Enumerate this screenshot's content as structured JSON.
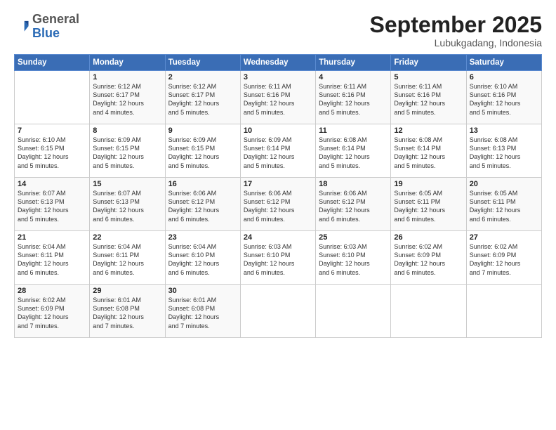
{
  "logo": {
    "general": "General",
    "blue": "Blue"
  },
  "header": {
    "month": "September 2025",
    "location": "Lubukgadang, Indonesia"
  },
  "weekdays": [
    "Sunday",
    "Monday",
    "Tuesday",
    "Wednesday",
    "Thursday",
    "Friday",
    "Saturday"
  ],
  "weeks": [
    [
      {
        "day": "",
        "sunrise": "",
        "sunset": "",
        "daylight": ""
      },
      {
        "day": "1",
        "sunrise": "Sunrise: 6:12 AM",
        "sunset": "Sunset: 6:17 PM",
        "daylight": "Daylight: 12 hours and 4 minutes."
      },
      {
        "day": "2",
        "sunrise": "Sunrise: 6:12 AM",
        "sunset": "Sunset: 6:17 PM",
        "daylight": "Daylight: 12 hours and 5 minutes."
      },
      {
        "day": "3",
        "sunrise": "Sunrise: 6:11 AM",
        "sunset": "Sunset: 6:16 PM",
        "daylight": "Daylight: 12 hours and 5 minutes."
      },
      {
        "day": "4",
        "sunrise": "Sunrise: 6:11 AM",
        "sunset": "Sunset: 6:16 PM",
        "daylight": "Daylight: 12 hours and 5 minutes."
      },
      {
        "day": "5",
        "sunrise": "Sunrise: 6:11 AM",
        "sunset": "Sunset: 6:16 PM",
        "daylight": "Daylight: 12 hours and 5 minutes."
      },
      {
        "day": "6",
        "sunrise": "Sunrise: 6:10 AM",
        "sunset": "Sunset: 6:16 PM",
        "daylight": "Daylight: 12 hours and 5 minutes."
      }
    ],
    [
      {
        "day": "7",
        "sunrise": "Sunrise: 6:10 AM",
        "sunset": "Sunset: 6:15 PM",
        "daylight": "Daylight: 12 hours and 5 minutes."
      },
      {
        "day": "8",
        "sunrise": "Sunrise: 6:09 AM",
        "sunset": "Sunset: 6:15 PM",
        "daylight": "Daylight: 12 hours and 5 minutes."
      },
      {
        "day": "9",
        "sunrise": "Sunrise: 6:09 AM",
        "sunset": "Sunset: 6:15 PM",
        "daylight": "Daylight: 12 hours and 5 minutes."
      },
      {
        "day": "10",
        "sunrise": "Sunrise: 6:09 AM",
        "sunset": "Sunset: 6:14 PM",
        "daylight": "Daylight: 12 hours and 5 minutes."
      },
      {
        "day": "11",
        "sunrise": "Sunrise: 6:08 AM",
        "sunset": "Sunset: 6:14 PM",
        "daylight": "Daylight: 12 hours and 5 minutes."
      },
      {
        "day": "12",
        "sunrise": "Sunrise: 6:08 AM",
        "sunset": "Sunset: 6:14 PM",
        "daylight": "Daylight: 12 hours and 5 minutes."
      },
      {
        "day": "13",
        "sunrise": "Sunrise: 6:08 AM",
        "sunset": "Sunset: 6:13 PM",
        "daylight": "Daylight: 12 hours and 5 minutes."
      }
    ],
    [
      {
        "day": "14",
        "sunrise": "Sunrise: 6:07 AM",
        "sunset": "Sunset: 6:13 PM",
        "daylight": "Daylight: 12 hours and 5 minutes."
      },
      {
        "day": "15",
        "sunrise": "Sunrise: 6:07 AM",
        "sunset": "Sunset: 6:13 PM",
        "daylight": "Daylight: 12 hours and 6 minutes."
      },
      {
        "day": "16",
        "sunrise": "Sunrise: 6:06 AM",
        "sunset": "Sunset: 6:12 PM",
        "daylight": "Daylight: 12 hours and 6 minutes."
      },
      {
        "day": "17",
        "sunrise": "Sunrise: 6:06 AM",
        "sunset": "Sunset: 6:12 PM",
        "daylight": "Daylight: 12 hours and 6 minutes."
      },
      {
        "day": "18",
        "sunrise": "Sunrise: 6:06 AM",
        "sunset": "Sunset: 6:12 PM",
        "daylight": "Daylight: 12 hours and 6 minutes."
      },
      {
        "day": "19",
        "sunrise": "Sunrise: 6:05 AM",
        "sunset": "Sunset: 6:11 PM",
        "daylight": "Daylight: 12 hours and 6 minutes."
      },
      {
        "day": "20",
        "sunrise": "Sunrise: 6:05 AM",
        "sunset": "Sunset: 6:11 PM",
        "daylight": "Daylight: 12 hours and 6 minutes."
      }
    ],
    [
      {
        "day": "21",
        "sunrise": "Sunrise: 6:04 AM",
        "sunset": "Sunset: 6:11 PM",
        "daylight": "Daylight: 12 hours and 6 minutes."
      },
      {
        "day": "22",
        "sunrise": "Sunrise: 6:04 AM",
        "sunset": "Sunset: 6:11 PM",
        "daylight": "Daylight: 12 hours and 6 minutes."
      },
      {
        "day": "23",
        "sunrise": "Sunrise: 6:04 AM",
        "sunset": "Sunset: 6:10 PM",
        "daylight": "Daylight: 12 hours and 6 minutes."
      },
      {
        "day": "24",
        "sunrise": "Sunrise: 6:03 AM",
        "sunset": "Sunset: 6:10 PM",
        "daylight": "Daylight: 12 hours and 6 minutes."
      },
      {
        "day": "25",
        "sunrise": "Sunrise: 6:03 AM",
        "sunset": "Sunset: 6:10 PM",
        "daylight": "Daylight: 12 hours and 6 minutes."
      },
      {
        "day": "26",
        "sunrise": "Sunrise: 6:02 AM",
        "sunset": "Sunset: 6:09 PM",
        "daylight": "Daylight: 12 hours and 6 minutes."
      },
      {
        "day": "27",
        "sunrise": "Sunrise: 6:02 AM",
        "sunset": "Sunset: 6:09 PM",
        "daylight": "Daylight: 12 hours and 7 minutes."
      }
    ],
    [
      {
        "day": "28",
        "sunrise": "Sunrise: 6:02 AM",
        "sunset": "Sunset: 6:09 PM",
        "daylight": "Daylight: 12 hours and 7 minutes."
      },
      {
        "day": "29",
        "sunrise": "Sunrise: 6:01 AM",
        "sunset": "Sunset: 6:08 PM",
        "daylight": "Daylight: 12 hours and 7 minutes."
      },
      {
        "day": "30",
        "sunrise": "Sunrise: 6:01 AM",
        "sunset": "Sunset: 6:08 PM",
        "daylight": "Daylight: 12 hours and 7 minutes."
      },
      {
        "day": "",
        "sunrise": "",
        "sunset": "",
        "daylight": ""
      },
      {
        "day": "",
        "sunrise": "",
        "sunset": "",
        "daylight": ""
      },
      {
        "day": "",
        "sunrise": "",
        "sunset": "",
        "daylight": ""
      },
      {
        "day": "",
        "sunrise": "",
        "sunset": "",
        "daylight": ""
      }
    ]
  ]
}
